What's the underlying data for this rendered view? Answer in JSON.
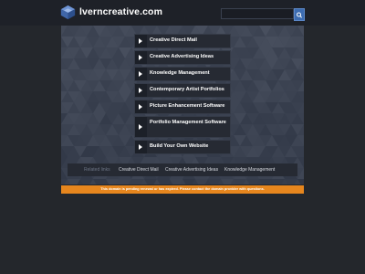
{
  "header": {
    "site_title": "lverncreative.com",
    "logo": "cube-logo",
    "search": {
      "placeholder": "",
      "button_icon": "search-icon"
    }
  },
  "links": [
    {
      "label": "Creative Direct Mail"
    },
    {
      "label": "Creative Advertising Ideas"
    },
    {
      "label": "Knowledge Management"
    },
    {
      "label": "Contemporary Artist Portfolios"
    },
    {
      "label": "Picture Enhancement Software"
    },
    {
      "label": "Portfolio Management Software"
    },
    {
      "label": "Build Your Own Website"
    }
  ],
  "related": {
    "heading": "Related links",
    "links": [
      "Creative Direct Mail",
      "Creative Advertising Ideas",
      "Knowledge Management"
    ]
  },
  "notice": "This domain is pending renewal or has expired. Please contact the domain provider with questions.",
  "colors": {
    "background": "#24272c",
    "panel": "#3e4657",
    "accent": "#3d6cb0",
    "notice_bg": "#e6861e"
  }
}
